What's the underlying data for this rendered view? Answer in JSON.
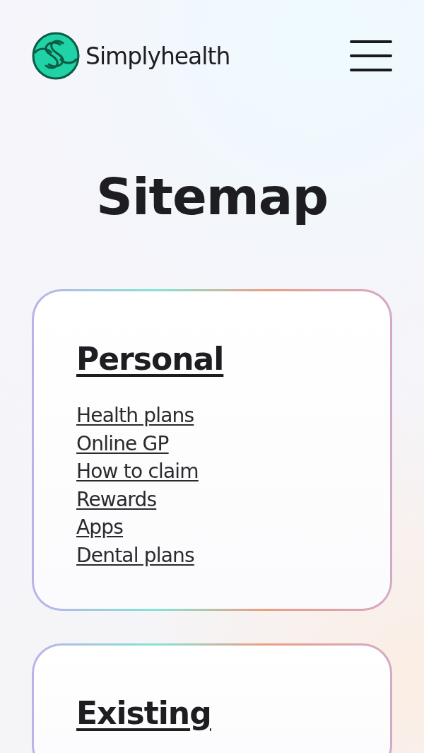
{
  "header": {
    "brand": "Simplyhealth"
  },
  "title": "Sitemap",
  "sections": [
    {
      "heading": "Personal",
      "links": [
        "Health plans",
        "Online GP",
        "How to claim",
        "Rewards",
        "Apps",
        "Dental plans"
      ]
    },
    {
      "heading": "Existing"
    }
  ]
}
